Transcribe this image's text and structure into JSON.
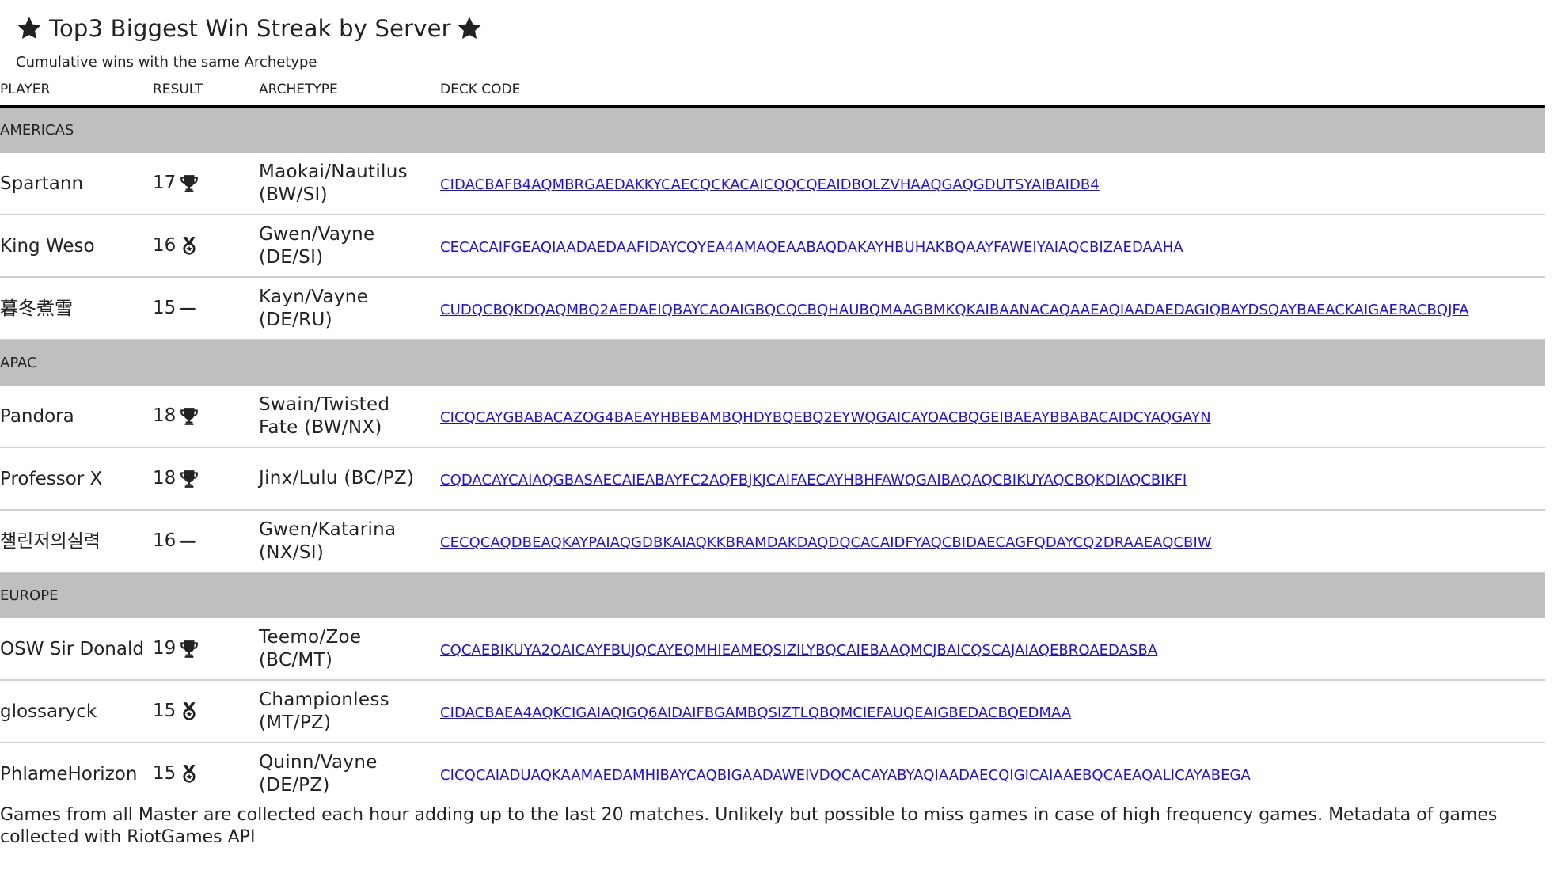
{
  "header": {
    "title": "Top3 Biggest Win Streak by Server",
    "subtitle": "Cumulative wins with the same Archetype"
  },
  "columns": [
    "PLAYER",
    "RESULT",
    "ARCHETYPE",
    "DECK CODE"
  ],
  "servers": [
    {
      "name": "AMERICAS",
      "rows": [
        {
          "player": "Spartann",
          "result": "17",
          "result_icon": "trophy-icon",
          "archetype": "Maokai/Nautilus (BW/SI)",
          "deck_code": "CIDACBAFB4AQMBRGAEDAKKYCAECQCKACAICQQCQEAIDBOLZVHAAQGAQGDUTSYAIBAIDB4"
        },
        {
          "player": "King Weso",
          "result": "16",
          "result_icon": "medal-icon",
          "archetype": "Gwen/Vayne (DE/SI)",
          "deck_code": "CECACAIFGEAQIAADAEDAAFIDAYCQYEA4AMAQEAABAQDAKAYHBUHAKBQAAYFAWEIYAIAQCBIZAEDAAHA"
        },
        {
          "player": "暮冬煮雪",
          "result": "15",
          "result_icon": "dash-icon",
          "archetype": "Kayn/Vayne (DE/RU)",
          "deck_code": "CUDQCBQKDQAQMBQ2AEDAEIQBAYCAOAIGBQCQCBQHAUBQMAAGBMKQKAIBAANACAQAAEAQIAADAEDAGIQBAYDSQAYBAEACKAIGAERACBQJFA"
        }
      ]
    },
    {
      "name": "APAC",
      "rows": [
        {
          "player": "Pandora",
          "result": "18",
          "result_icon": "trophy-icon",
          "archetype": "Swain/Twisted Fate (BW/NX)",
          "deck_code": "CICQCAYGBABACAZOG4BAEAYHBEBAMBQHDYBQEBQ2EYWQGAICAYOACBQGEIBAEAYBBABACAIDCYAQGAYN"
        },
        {
          "player": "Professor X",
          "result": "18",
          "result_icon": "trophy-icon",
          "archetype": "Jinx/Lulu (BC/PZ)",
          "deck_code": "CQDACAYCAIAQGBASAECAIEABAYFC2AQFBJKJCAIFAECAYHBHFAWQGAIBAQAQCBIKUYAQCBQKDIAQCBIKFI"
        },
        {
          "player": "챌린저의실력",
          "result": "16",
          "result_icon": "dash-icon",
          "archetype": "Gwen/Katarina (NX/SI)",
          "deck_code": "CECQCAQDBEAQKAYPAIAQGDBKAIAQKKBRAMDAKDAQDQCACAIDFYAQCBIDAECAGFQDAYCQ2DRAAEAQCBIW"
        }
      ]
    },
    {
      "name": "EUROPE",
      "rows": [
        {
          "player": "OSW Sir Donald",
          "result": "19",
          "result_icon": "trophy-icon",
          "archetype": "Teemo/Zoe (BC/MT)",
          "deck_code": "CQCAEBIKUYA2OAICAYFBUJQCAYEQMHIEAMEQSIZILYBQCAIEBAAQMCJBAICQSCAJAIAQEBROAEDASBA"
        },
        {
          "player": "glossaryck",
          "result": "15",
          "result_icon": "medal-icon",
          "archetype": "Championless (MT/PZ)",
          "deck_code": "CIDACBAEA4AQKCIGAIAQIGQ6AIDAIFBGAMBQSIZTLQBQMCIEFAUQEAIGBEDACBQEDMAA"
        },
        {
          "player": "PhlameHorizon",
          "result": "15",
          "result_icon": "medal-icon",
          "archetype": "Quinn/Vayne (DE/PZ)",
          "deck_code": "CICQCAIADUAQKAAMAEDAMHIBAYCAQBIGAADAWEIVDQCACAYABYAQIAADAECQIGICAIAAEBQCAEAQALICAYABEGA"
        }
      ]
    }
  ],
  "footer": "Games from all Master are collected each hour adding up to the last 20 matches. Unlikely but possible to miss games in case of high frequency games. Metadata of games collected with RiotGames API"
}
